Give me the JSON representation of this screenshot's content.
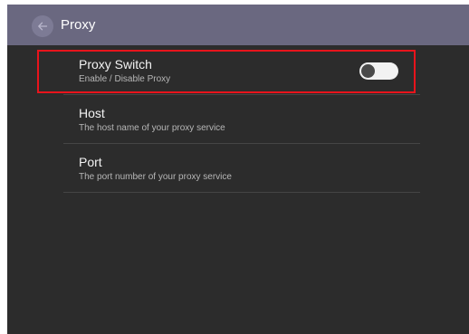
{
  "app_bar": {
    "title": "Proxy",
    "back_icon": "arrow-left-icon"
  },
  "settings": [
    {
      "title": "Proxy Switch",
      "subtitle": "Enable / Disable Proxy",
      "control": "toggle",
      "enabled": false
    },
    {
      "title": "Host",
      "subtitle": "The host name of your proxy service"
    },
    {
      "title": "Port",
      "subtitle": "The port number of your proxy service"
    }
  ],
  "colors": {
    "app_bar": "#6a6880",
    "background": "#2c2c2c",
    "highlight": "#e8141c",
    "toggle_track": "#f2f2f2",
    "toggle_knob": "#4a4a4a"
  }
}
